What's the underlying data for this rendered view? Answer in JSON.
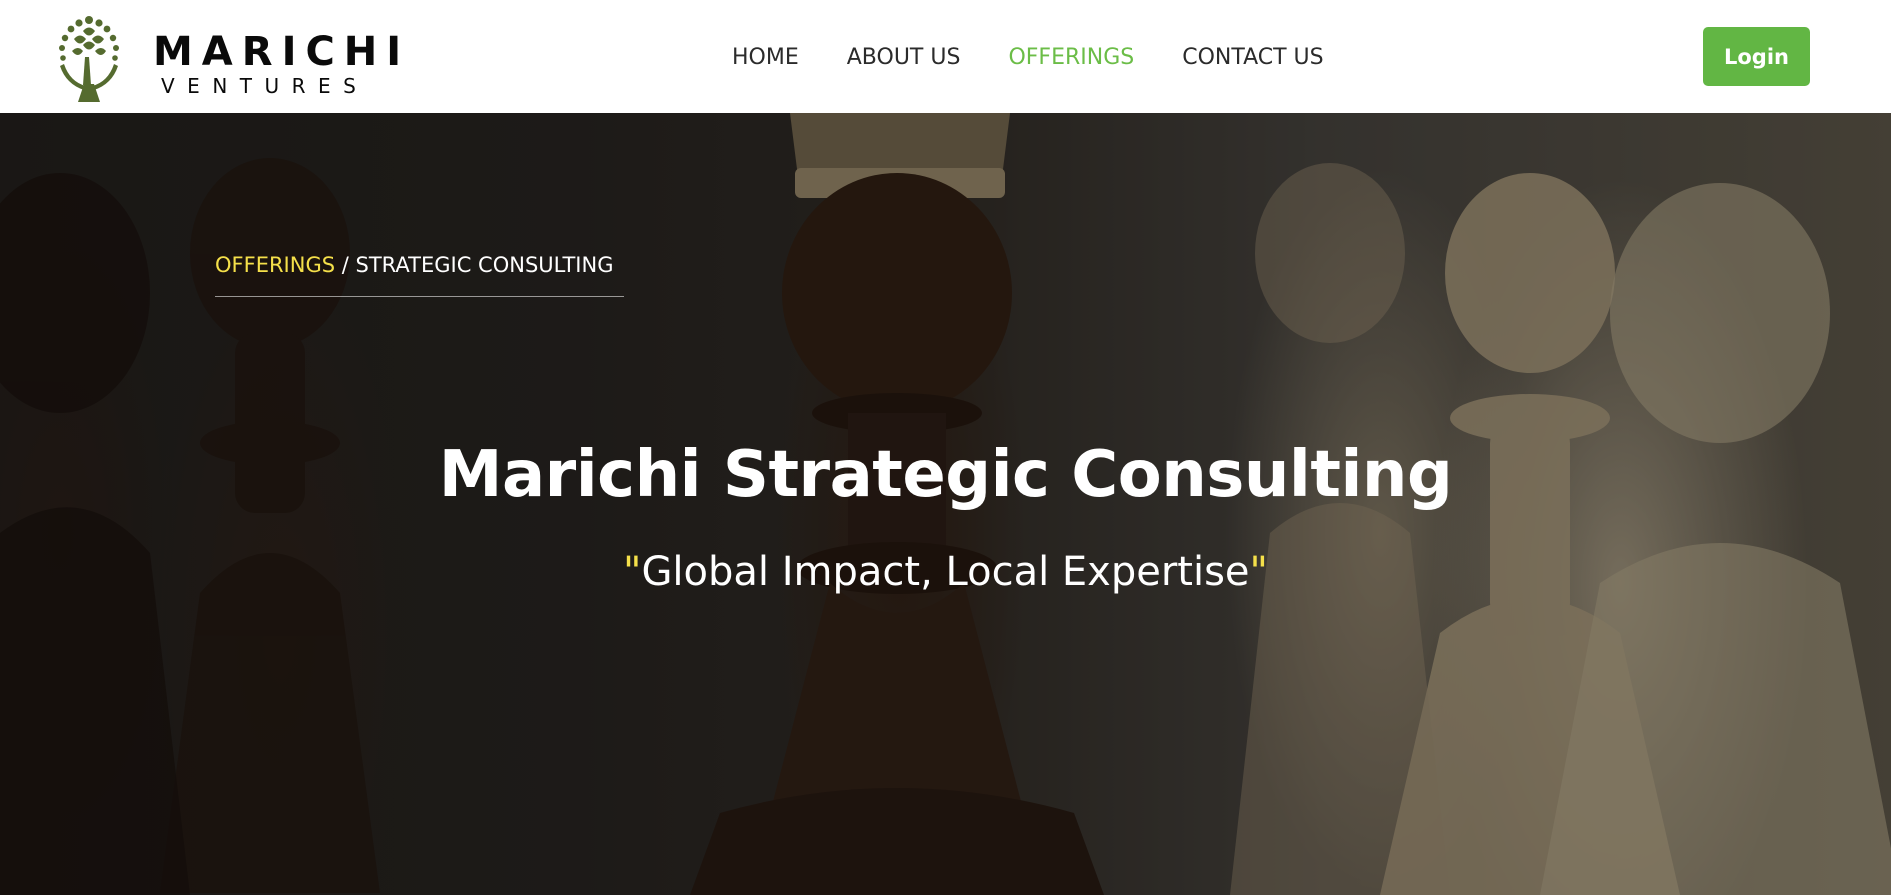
{
  "brand": {
    "name": "MARICHI",
    "sub": "VENTURES",
    "accent_color": "#556b2f"
  },
  "nav": {
    "items": [
      {
        "label": "HOME",
        "active": false
      },
      {
        "label": "ABOUT US",
        "active": false
      },
      {
        "label": "OFFERINGS",
        "active": true
      },
      {
        "label": "CONTACT US",
        "active": false
      }
    ],
    "active_color": "#6bbd47"
  },
  "header": {
    "login_label": "Login",
    "login_color": "#62b644"
  },
  "hero": {
    "breadcrumb": {
      "parent": "OFFERINGS",
      "separator": "/",
      "current": "STRATEGIC CONSULTING"
    },
    "title": "Marichi Strategic Consulting",
    "tagline": {
      "open_quote": "\"",
      "text": "Global Impact, Local Expertise",
      "close_quote": "\""
    },
    "background": "chess-pieces-photo",
    "highlight_color": "#f5e04a"
  }
}
